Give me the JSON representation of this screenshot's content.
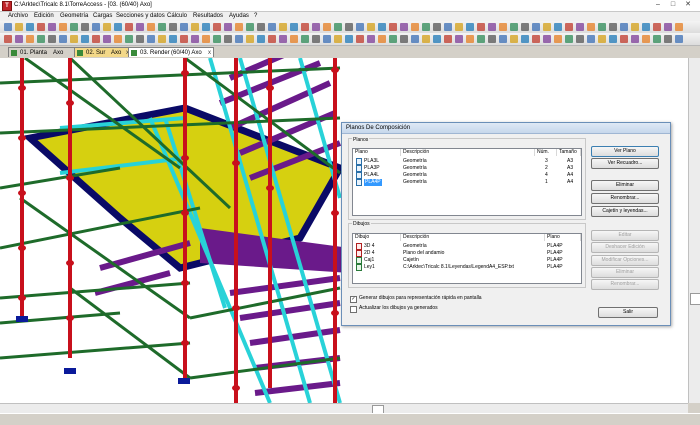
{
  "window": {
    "app_icon": "T",
    "title": "C:\\Arktec\\Tricalc 8.1\\TorreAccess - [03.  (60/40)  Axo]"
  },
  "menu": [
    "Archivo",
    "Edición",
    "Geometría",
    "Cargas",
    "Secciones y datos",
    "Cálculo",
    "Resultados",
    "Ayudas",
    "?"
  ],
  "tabs": [
    {
      "label": "01. Planta",
      "suffix": "Axo",
      "bg": "#d4d0c8"
    },
    {
      "label": "02. Sur",
      "suffix": "Axo",
      "bg": "#f3d888"
    },
    {
      "label": "03. Render",
      "suffix": "(60/40)  Axo",
      "bg": "#ffffff"
    }
  ],
  "dialog": {
    "title": "Planos De Composición",
    "planos_group": "Planos",
    "planos_columns": [
      "Plano",
      "Descripción",
      "Núm.",
      "Tamaño"
    ],
    "planos_rows": [
      {
        "plano": "PLA3L",
        "desc": "Geometría",
        "num": "3",
        "size": "A3",
        "selected": false
      },
      {
        "plano": "PLA3P",
        "desc": "Geometría",
        "num": "2",
        "size": "A3",
        "selected": false
      },
      {
        "plano": "PLA4L",
        "desc": "Geometría",
        "num": "4",
        "size": "A4",
        "selected": false
      },
      {
        "plano": "PLA4P",
        "desc": "Geometría",
        "num": "1",
        "size": "A4",
        "selected": true
      }
    ],
    "planos_buttons": {
      "ver_plano": "Ver Plano",
      "ver_recuadro": "Ver Recuadro...",
      "eliminar": "Eliminar",
      "renombrar": "Renombrar...",
      "cajetin": "Cajetín y leyendas..."
    },
    "dibujos_group": "Dibujos",
    "dibujos_columns": [
      "Dibujo",
      "Descripción",
      "Plano"
    ],
    "dibujos_rows": [
      {
        "dibujo": "3D 4",
        "desc": "Geometría",
        "plano": "PLA4P"
      },
      {
        "dibujo": "2D 4",
        "desc": "Plano del andamio",
        "plano": "PLA4P"
      },
      {
        "dibujo": "Caj1",
        "desc": "Cajetín",
        "plano": "PLA4P"
      },
      {
        "dibujo": "Ley1",
        "desc": "C:\\Arktec\\Tricalc 8.1\\Leyendas\\LegendA4_ESP.txt",
        "plano": "PLA4P"
      }
    ],
    "dibujos_buttons": {
      "editar": "Editar",
      "deshacer": "Deshacer Edición",
      "modificar": "Modificar Opciones...",
      "eliminar": "Eliminar",
      "renombrar": "Renombrar..."
    },
    "check_generar": {
      "label": "Generar dibujos para representación rápida en pantalla",
      "checked": true
    },
    "check_actualizar": {
      "label": "Actualizar los dibujos ya generados",
      "checked": false
    },
    "salir": "Salir"
  },
  "colors": {
    "column_red": "#c8101c",
    "beam_green": "#1e6b2a",
    "stair_cyan": "#28d2d8",
    "stair_purple": "#6a1a8a",
    "platform_yellow": "#d6d010",
    "platform_navy": "#0a0a66"
  }
}
